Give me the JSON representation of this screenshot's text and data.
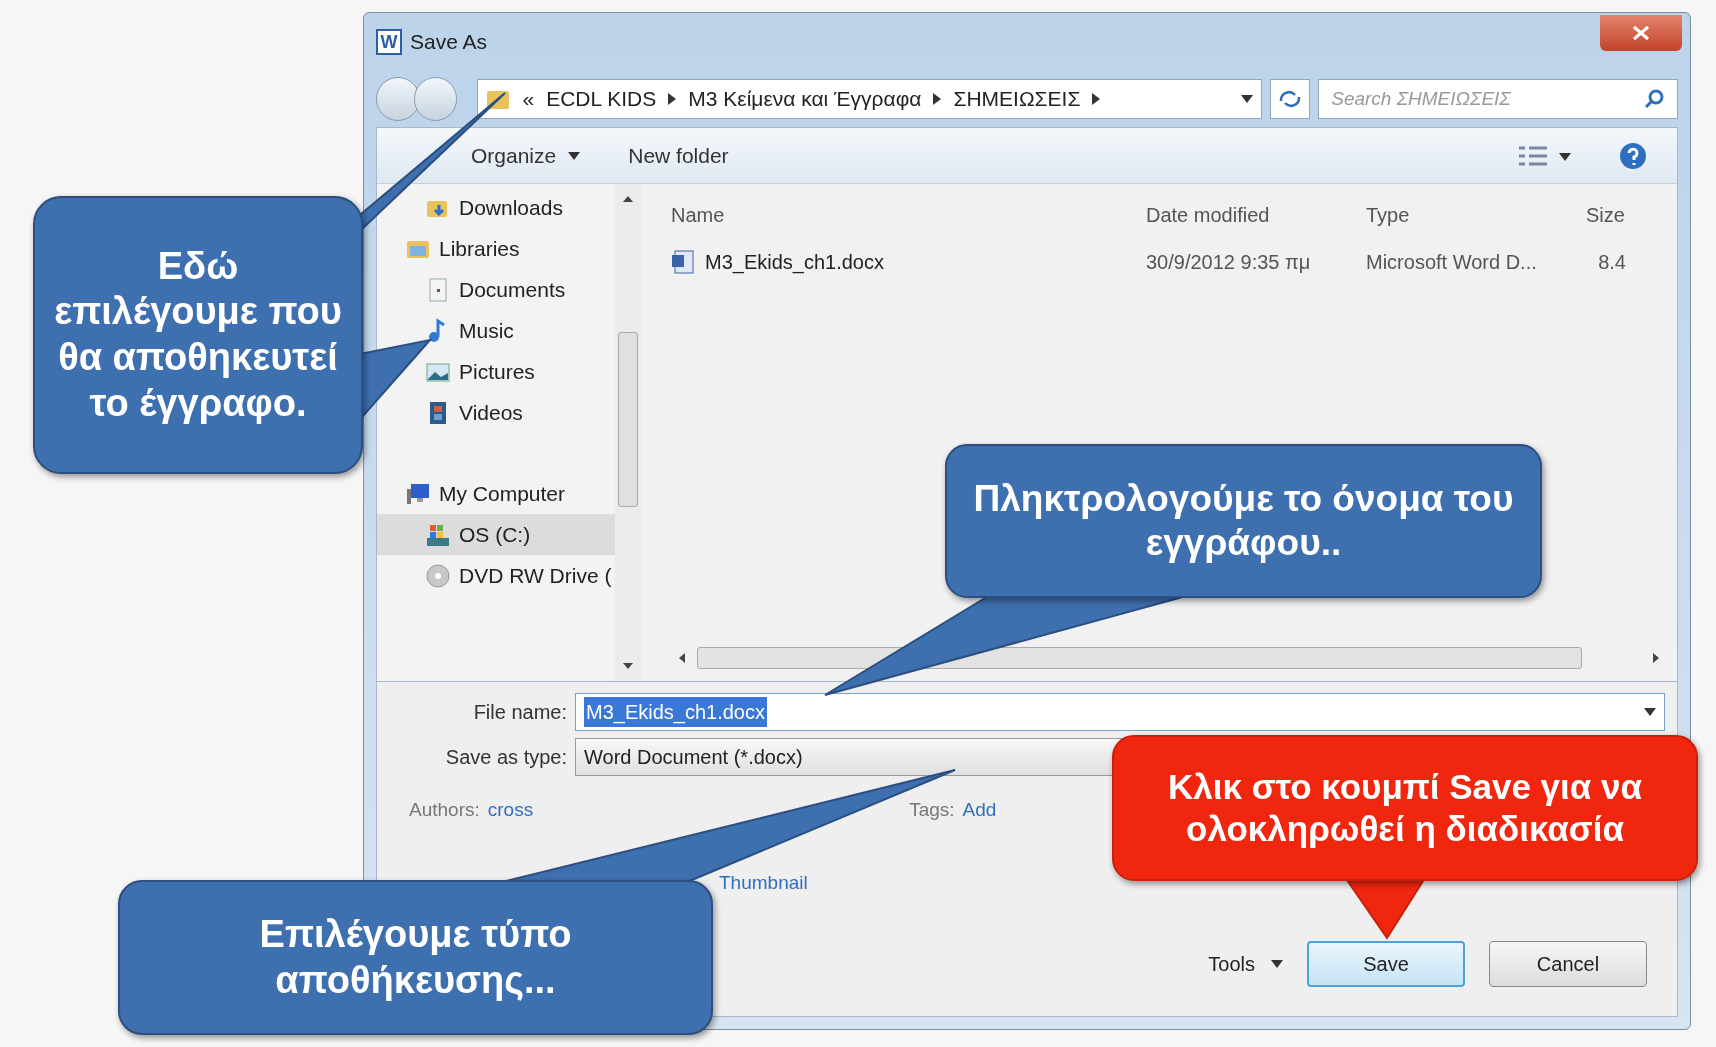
{
  "window": {
    "title": "Save As",
    "app_letter": "W"
  },
  "address": {
    "prefix": "«",
    "crumbs": [
      "ECDL KIDS",
      "M3 Κείμενα και Έγγραφα",
      "ΣΗΜΕΙΩΣΕΙΣ"
    ]
  },
  "search": {
    "placeholder": "Search ΣΗΜΕΙΩΣΕΙΣ"
  },
  "toolbar": {
    "organize": "Organize",
    "new_folder": "New folder"
  },
  "sidebar": {
    "items": [
      {
        "label": "Downloads",
        "kind": "downloads",
        "selected": false
      },
      {
        "label": "Libraries",
        "kind": "libraries",
        "selected": false,
        "children": [
          {
            "label": "Documents",
            "kind": "documents",
            "selected": false
          },
          {
            "label": "Music",
            "kind": "music",
            "selected": false
          },
          {
            "label": "Pictures",
            "kind": "pictures",
            "selected": false
          },
          {
            "label": "Videos",
            "kind": "videos",
            "selected": false
          }
        ]
      },
      {
        "label": "My Computer",
        "kind": "computer",
        "selected": false,
        "children": [
          {
            "label": "OS (C:)",
            "kind": "drive",
            "selected": true
          },
          {
            "label": "DVD RW Drive (",
            "kind": "disc",
            "selected": false
          }
        ]
      }
    ]
  },
  "file_list": {
    "columns": [
      "Name",
      "Date modified",
      "Type",
      "Size"
    ],
    "rows": [
      {
        "name": "M3_Ekids_ch1.docx",
        "date": "30/9/2012 9:35 πμ",
        "type": "Microsoft Word D...",
        "size": "8.4"
      }
    ]
  },
  "form": {
    "file_name": {
      "label": "File name:",
      "value": "M3_Ekids_ch1.docx"
    },
    "save_type": {
      "label": "Save as type:",
      "value": "Word Document (*.docx)"
    },
    "authors": {
      "label": "Authors:",
      "value": "cross"
    },
    "tags": {
      "label": "Tags:",
      "value": "Add"
    },
    "thumbnail": "Thumbnail"
  },
  "buttons": {
    "tools": "Tools",
    "save": "Save",
    "cancel": "Cancel"
  },
  "callouts": [
    {
      "kind": "blue",
      "text": "Εδώ επιλέγουμε που θα αποθηκευτεί το έγγραφο."
    },
    {
      "kind": "blue",
      "text": "Πληκτρολογούμε το όνομα του εγγράφου.."
    },
    {
      "kind": "red",
      "text": "Κλικ στο κουμπί Save για να ολοκληρωθεί η διαδικασία"
    },
    {
      "kind": "blue",
      "text": "Επιλέγουμε τύπο αποθήκευσης..."
    }
  ]
}
